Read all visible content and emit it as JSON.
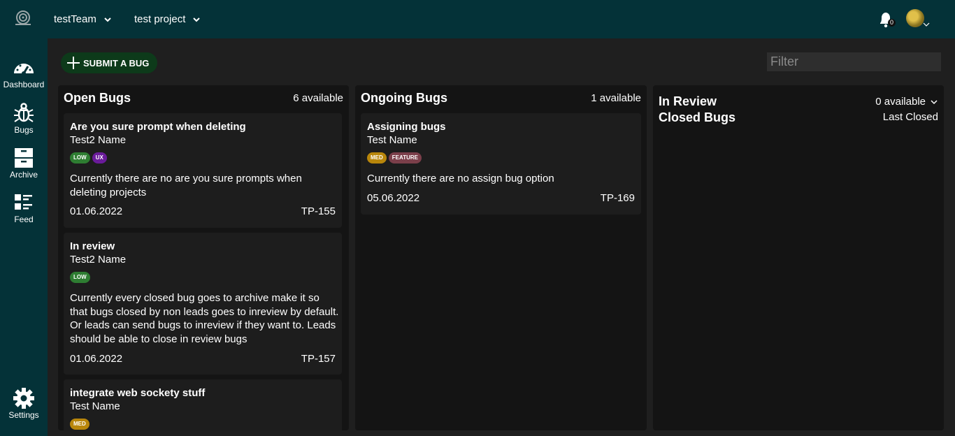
{
  "header": {
    "team": "testTeam",
    "project": "test project",
    "notification_count": "0"
  },
  "sidebar": {
    "items": [
      {
        "label": "Dashboard",
        "icon": "dashboard-icon"
      },
      {
        "label": "Bugs",
        "icon": "bug-icon"
      },
      {
        "label": "Archive",
        "icon": "archive-icon"
      },
      {
        "label": "Feed",
        "icon": "feed-icon"
      },
      {
        "label": "Settings",
        "icon": "gear-icon"
      }
    ]
  },
  "toolbar": {
    "submit_label": "SUBMIT A BUG",
    "filter_placeholder": "Filter"
  },
  "columns": {
    "open": {
      "title": "Open Bugs",
      "count": "6 available",
      "cards": [
        {
          "title": "Are you sure prompt when deleting",
          "assignee": "Test2 Name",
          "tags": [
            "LOW",
            "UX"
          ],
          "description": "Currently there are no are you sure prompts when deleting projects",
          "date": "01.06.2022",
          "id": "TP-155"
        },
        {
          "title": "In review",
          "assignee": "Test2 Name",
          "tags": [
            "LOW"
          ],
          "description": "Currently every closed bug goes to archive make it so that bugs closed by non leads goes to inreview by default. Or leads can send bugs to inreview if they want to. Leads should be able to close in review bugs",
          "date": "01.06.2022",
          "id": "TP-157"
        },
        {
          "title": "integrate web sockety stuff",
          "assignee": "Test Name",
          "tags": [
            "MED"
          ]
        }
      ]
    },
    "ongoing": {
      "title": "Ongoing Bugs",
      "count": "1 available",
      "cards": [
        {
          "title": "Assigning bugs",
          "assignee": "Test Name",
          "tags": [
            "MED",
            "FEATURE"
          ],
          "description": "Currently there are no assign bug option",
          "date": "05.06.2022",
          "id": "TP-169"
        }
      ]
    },
    "review": {
      "title": "In Review",
      "closed_title": "Closed Bugs",
      "count": "0 available",
      "sort_label": "Last Closed"
    }
  },
  "colors": {
    "topbar": "#043238",
    "low": "#2e7d32",
    "ux": "#6a1b9a",
    "med": "#b8860b",
    "feature": "#7b3f4a"
  }
}
